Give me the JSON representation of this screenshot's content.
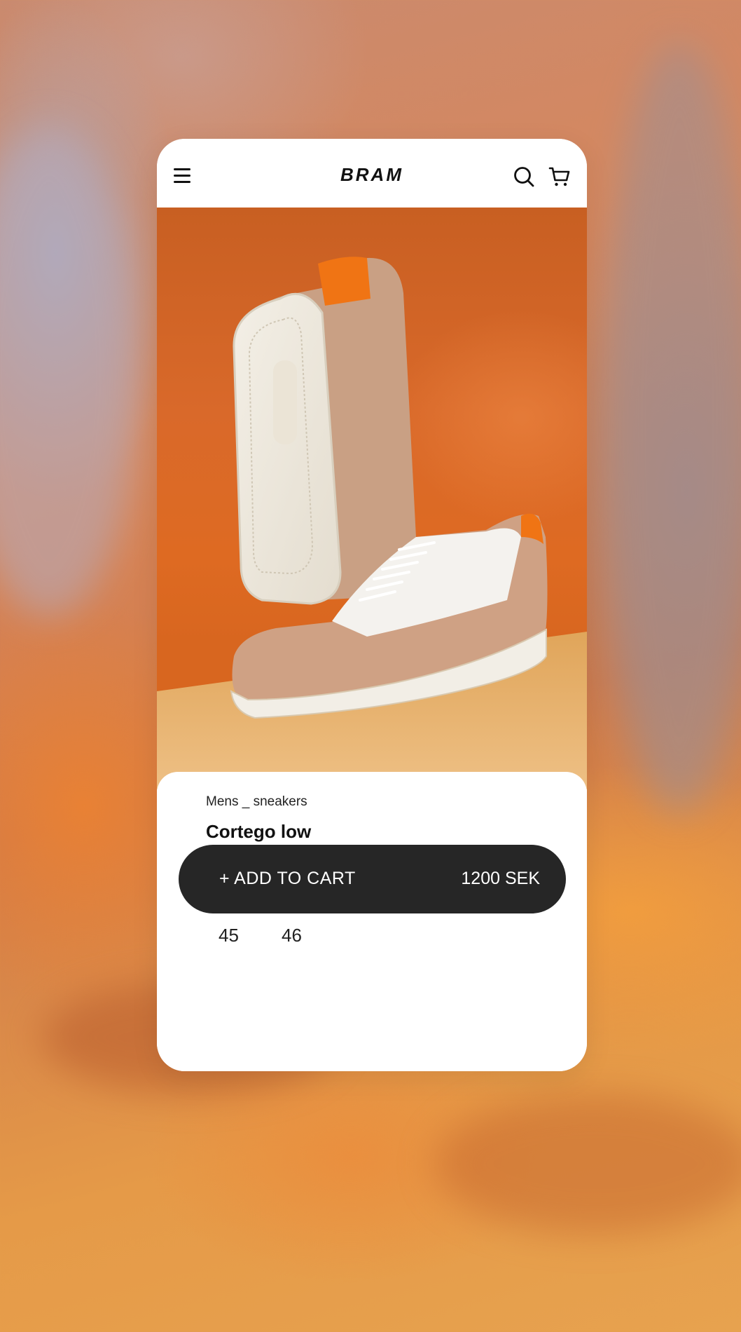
{
  "header": {
    "brand": "BRAM",
    "menu_icon": "menu-icon",
    "search_icon": "search-icon",
    "cart_icon": "cart-icon"
  },
  "product": {
    "category": "Mens _ sneakers",
    "name": "Cortego low",
    "sizes": [
      "45",
      "46"
    ],
    "price": "1200 SEK",
    "image": "sneakers-photo"
  },
  "cta": {
    "label": "+ ADD TO CART"
  },
  "colors": {
    "accent_dark": "#262626",
    "hero_orange": "#d9692a",
    "floor_sand": "#e8b871"
  }
}
